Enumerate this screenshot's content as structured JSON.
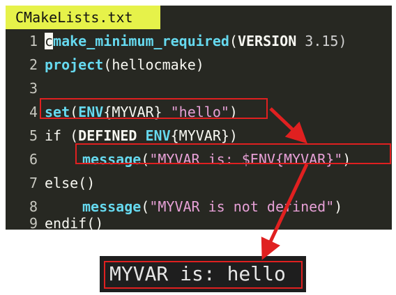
{
  "editor": {
    "tab_title": "CMakeLists.txt",
    "lines": [
      {
        "num": "1",
        "cursor": "c",
        "a": "make_minimum_required",
        "b": "(",
        "c": "VERSION",
        "d": " 3.15)"
      },
      {
        "num": "2",
        "a": "project",
        "b": "(hellocmake)"
      },
      {
        "num": "3"
      },
      {
        "num": "4",
        "a": "set",
        "b": "(",
        "c": "ENV",
        "d": "{MYVAR} ",
        "e": "\"hello\"",
        "f": ")"
      },
      {
        "num": "5",
        "a": "if ",
        "b": "(",
        "c": "DEFINED",
        "d": " ",
        "e": "ENV",
        "f": "{MYVAR})"
      },
      {
        "num": "6",
        "a": "message",
        "b": "(",
        "c": "\"MYVAR is: $ENV{MYVAR}\"",
        "d": ")"
      },
      {
        "num": "7",
        "a": "else()"
      },
      {
        "num": "8",
        "a": "message",
        "b": "(",
        "c": "\"MYVAR is not defined\"",
        "d": ")"
      },
      {
        "num": "9",
        "a": "endif()"
      }
    ]
  },
  "terminal": {
    "output": "MYVAR is: hello"
  },
  "colors": {
    "editor_bg": "#272822",
    "tab_bg": "#e6f24a",
    "keyword": "#66d9ef",
    "string": "#e6a0d6",
    "highlight": "#e02020"
  }
}
